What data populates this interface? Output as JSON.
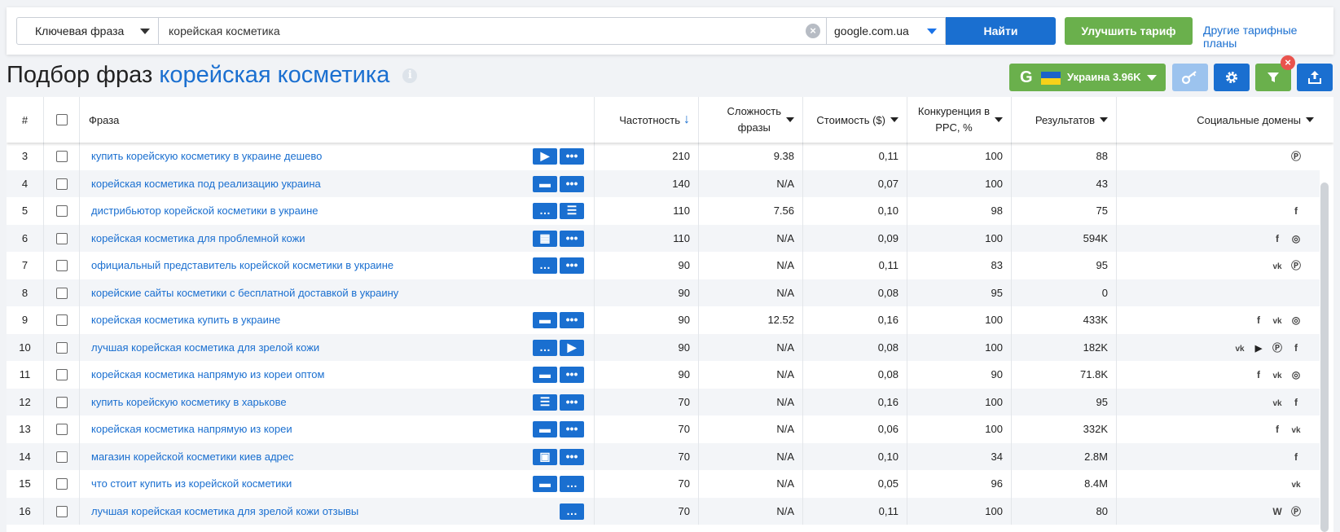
{
  "search": {
    "mode_label": "Ключевая фраза",
    "query": "корейская косметика",
    "engine": "google.com.ua",
    "find_label": "Найти",
    "upgrade_label": "Улучшить тариф",
    "plans_link": "Другие тарифные планы"
  },
  "title": {
    "prefix": "Подбор фраз",
    "keyword": "корейская косметика"
  },
  "region": {
    "engine_letter": "G",
    "label": "Украина 3.96K"
  },
  "colors": {
    "accent": "#1a6fd0",
    "green": "#6ab04c",
    "light_blue": "#9cc3ee",
    "danger": "#e9534d"
  },
  "table": {
    "headers": {
      "num": "#",
      "phrase": "Фраза",
      "freq": "Частотность",
      "diff_line1": "Сложность",
      "diff_line2": "фразы",
      "cost": "Стоимость ($)",
      "ppc_line1": "Конкуренция в",
      "ppc_line2": "PPC, %",
      "results": "Результатов",
      "social": "Социальные домены"
    },
    "rows": [
      {
        "num": "3",
        "phrase": "купить корейскую косметику в украине дешево",
        "features": [
          "video",
          "more"
        ],
        "freq": "210",
        "diff": "9.38",
        "cost": "0,11",
        "ppc": "100",
        "results": "88",
        "social": [
          "pinterest"
        ]
      },
      {
        "num": "4",
        "phrase": "корейская косметика под реализацию украина",
        "features": [
          "shop",
          "more"
        ],
        "freq": "140",
        "diff": "N/A",
        "cost": "0,07",
        "ppc": "100",
        "results": "43",
        "social": []
      },
      {
        "num": "5",
        "phrase": "дистрибьютор корейской косметики в украине",
        "features": [
          "chat",
          "list"
        ],
        "freq": "110",
        "diff": "7.56",
        "cost": "0,10",
        "ppc": "98",
        "results": "75",
        "social": [
          "facebook"
        ]
      },
      {
        "num": "6",
        "phrase": "корейская косметика для проблемной кожи",
        "features": [
          "grid",
          "more"
        ],
        "freq": "110",
        "diff": "N/A",
        "cost": "0,09",
        "ppc": "100",
        "results": "594K",
        "social": [
          "facebook",
          "instagram"
        ]
      },
      {
        "num": "7",
        "phrase": "официальный представитель корейской косметики в украине",
        "features": [
          "chat",
          "more"
        ],
        "freq": "90",
        "diff": "N/A",
        "cost": "0,11",
        "ppc": "83",
        "results": "95",
        "social": [
          "vk",
          "pinterest"
        ]
      },
      {
        "num": "8",
        "phrase": "корейские сайты косметики с бесплатной доставкой в украину",
        "features": [],
        "freq": "90",
        "diff": "N/A",
        "cost": "0,08",
        "ppc": "95",
        "results": "0",
        "social": []
      },
      {
        "num": "9",
        "phrase": "корейская косметика купить в украине",
        "features": [
          "shop",
          "more"
        ],
        "freq": "90",
        "diff": "12.52",
        "cost": "0,16",
        "ppc": "100",
        "results": "433K",
        "social": [
          "facebook",
          "vk",
          "instagram"
        ]
      },
      {
        "num": "10",
        "phrase": "лучшая корейская косметика для зрелой кожи",
        "features": [
          "chat",
          "video"
        ],
        "freq": "90",
        "diff": "N/A",
        "cost": "0,08",
        "ppc": "100",
        "results": "182K",
        "social": [
          "vk",
          "youtube",
          "pinterest",
          "facebook"
        ]
      },
      {
        "num": "11",
        "phrase": "корейская косметика напрямую из кореи оптом",
        "features": [
          "shop",
          "more"
        ],
        "freq": "90",
        "diff": "N/A",
        "cost": "0,08",
        "ppc": "90",
        "results": "71.8K",
        "social": [
          "facebook",
          "vk",
          "instagram"
        ]
      },
      {
        "num": "12",
        "phrase": "купить корейскую косметику в харькове",
        "features": [
          "list",
          "more"
        ],
        "freq": "70",
        "diff": "N/A",
        "cost": "0,16",
        "ppc": "100",
        "results": "95",
        "social": [
          "vk",
          "facebook"
        ]
      },
      {
        "num": "13",
        "phrase": "корейская косметика напрямую из кореи",
        "features": [
          "shop",
          "more"
        ],
        "freq": "70",
        "diff": "N/A",
        "cost": "0,06",
        "ppc": "100",
        "results": "332K",
        "social": [
          "facebook",
          "vk"
        ]
      },
      {
        "num": "14",
        "phrase": "магазин корейской косметики киев адрес",
        "features": [
          "image",
          "more"
        ],
        "freq": "70",
        "diff": "N/A",
        "cost": "0,10",
        "ppc": "34",
        "results": "2.8M",
        "social": [
          "facebook"
        ]
      },
      {
        "num": "15",
        "phrase": "что стоит купить из корейской косметики",
        "features": [
          "shop",
          "chat"
        ],
        "freq": "70",
        "diff": "N/A",
        "cost": "0,05",
        "ppc": "96",
        "results": "8.4M",
        "social": [
          "vk"
        ]
      },
      {
        "num": "16",
        "phrase": "лучшая корейская косметика для зрелой кожи отзывы",
        "features": [
          "chat"
        ],
        "freq": "70",
        "diff": "N/A",
        "cost": "0,11",
        "ppc": "100",
        "results": "80",
        "social": [
          "wikipedia",
          "pinterest"
        ]
      }
    ]
  }
}
